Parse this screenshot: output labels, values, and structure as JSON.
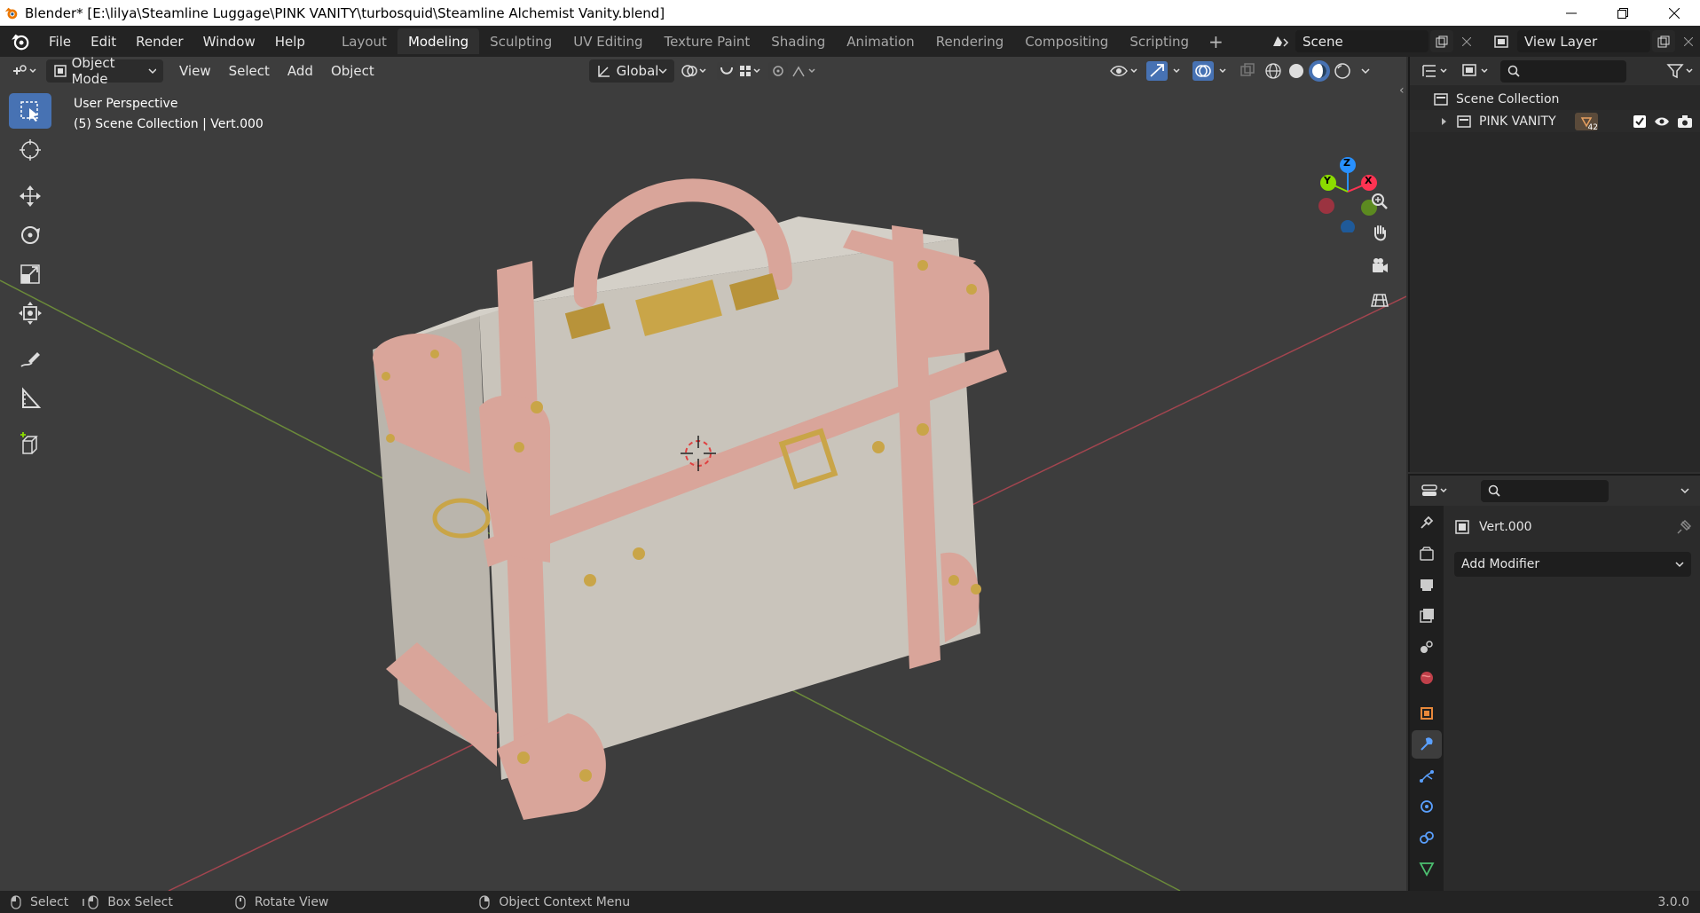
{
  "window": {
    "title": "Blender* [E:\\lilya\\Steamline Luggage\\PINK VANITY\\turbosquid\\Steamline Alchemist Vanity.blend]"
  },
  "menu": {
    "items": [
      "File",
      "Edit",
      "Render",
      "Window",
      "Help"
    ]
  },
  "workspaces": {
    "tabs": [
      "Layout",
      "Modeling",
      "Sculpting",
      "UV Editing",
      "Texture Paint",
      "Shading",
      "Animation",
      "Rendering",
      "Compositing",
      "Scripting"
    ],
    "active": "Modeling"
  },
  "scene": {
    "name": "Scene"
  },
  "view_layer": {
    "name": "View Layer"
  },
  "viewport_header": {
    "mode": "Object Mode",
    "menus": [
      "View",
      "Select",
      "Add",
      "Object"
    ],
    "orientation": "Global"
  },
  "viewport": {
    "perspective": "User Perspective",
    "collection_info": "(5) Scene Collection | Vert.000",
    "axes": [
      "X",
      "Y",
      "Z"
    ]
  },
  "outliner": {
    "root": "Scene Collection",
    "items": [
      {
        "name": "PINK VANITY",
        "badge": "42"
      }
    ]
  },
  "properties": {
    "object_name": "Vert.000",
    "add_modifier": "Add Modifier"
  },
  "statusbar": {
    "items": [
      "Select",
      "Box Select",
      "Rotate View",
      "Object Context Menu"
    ],
    "version": "3.0.0"
  },
  "colors": {
    "accent": "#4772b3",
    "x_axis": "#ff3352",
    "y_axis": "#8bdc00",
    "z_axis": "#2890ff",
    "suitcase_body": "#c9c4bb",
    "suitcase_leather": "#d9a59a",
    "brass": "#c9a548"
  }
}
